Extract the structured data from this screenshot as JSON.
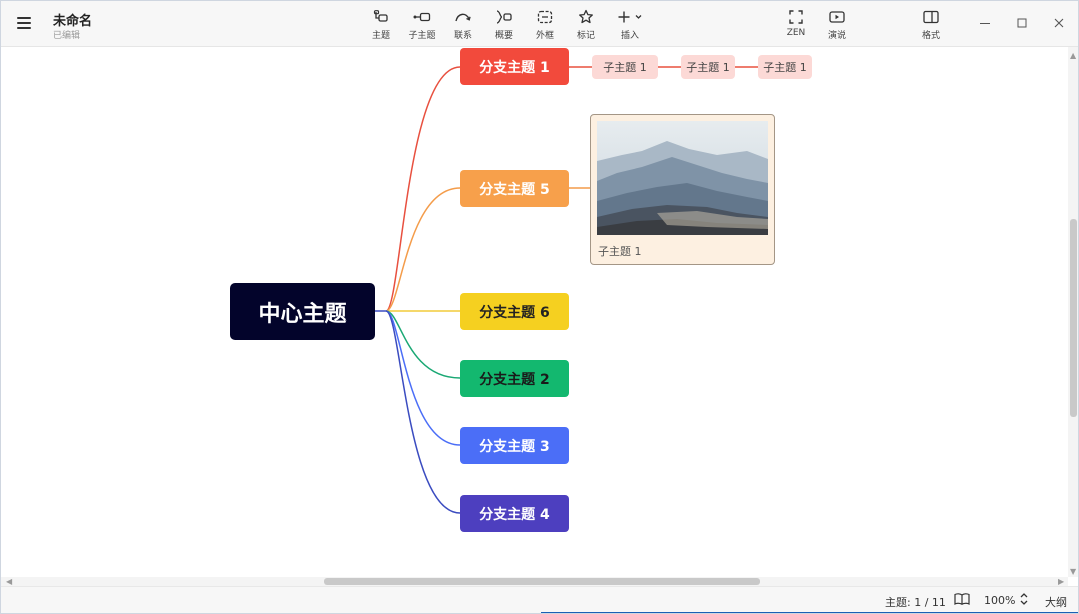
{
  "app": {
    "title": "未命名",
    "status": "已编辑"
  },
  "toolbar": {
    "items": [
      {
        "label": "主题",
        "icon": "topic-icon"
      },
      {
        "label": "子主题",
        "icon": "subtopic-icon"
      },
      {
        "label": "联系",
        "icon": "relationship-icon"
      },
      {
        "label": "概要",
        "icon": "summary-icon"
      },
      {
        "label": "外框",
        "icon": "boundary-icon"
      },
      {
        "label": "标记",
        "icon": "star-icon"
      },
      {
        "label": "插入",
        "icon": "plus-icon"
      }
    ],
    "zen": "ZEN",
    "present": "演说",
    "format": "格式"
  },
  "mindmap": {
    "central": {
      "label": "中心主题",
      "color": "#03042b"
    },
    "branches": [
      {
        "label": "分支主题 1",
        "color": "#f24a3c",
        "line": "#e8503f"
      },
      {
        "label": "分支主题 5",
        "color": "#f7a04b",
        "line": "#f49c4a"
      },
      {
        "label": "分支主题 6",
        "color": "#f5d020",
        "line": "#f2cc3a"
      },
      {
        "label": "分支主题 2",
        "color": "#13b86f",
        "line": "#1aa874"
      },
      {
        "label": "分支主题 3",
        "color": "#4b6ef7",
        "line": "#4b6ef7"
      },
      {
        "label": "分支主题 4",
        "color": "#4d3fbf",
        "line": "#3b4cc0"
      }
    ],
    "subtopics": [
      "子主题 1",
      "子主题 1",
      "子主题 1"
    ],
    "image_topic": {
      "caption": "子主题 1"
    }
  },
  "statusbar": {
    "topics": "主题: 1 / 11",
    "zoom": "100%",
    "outline": "大纲"
  }
}
